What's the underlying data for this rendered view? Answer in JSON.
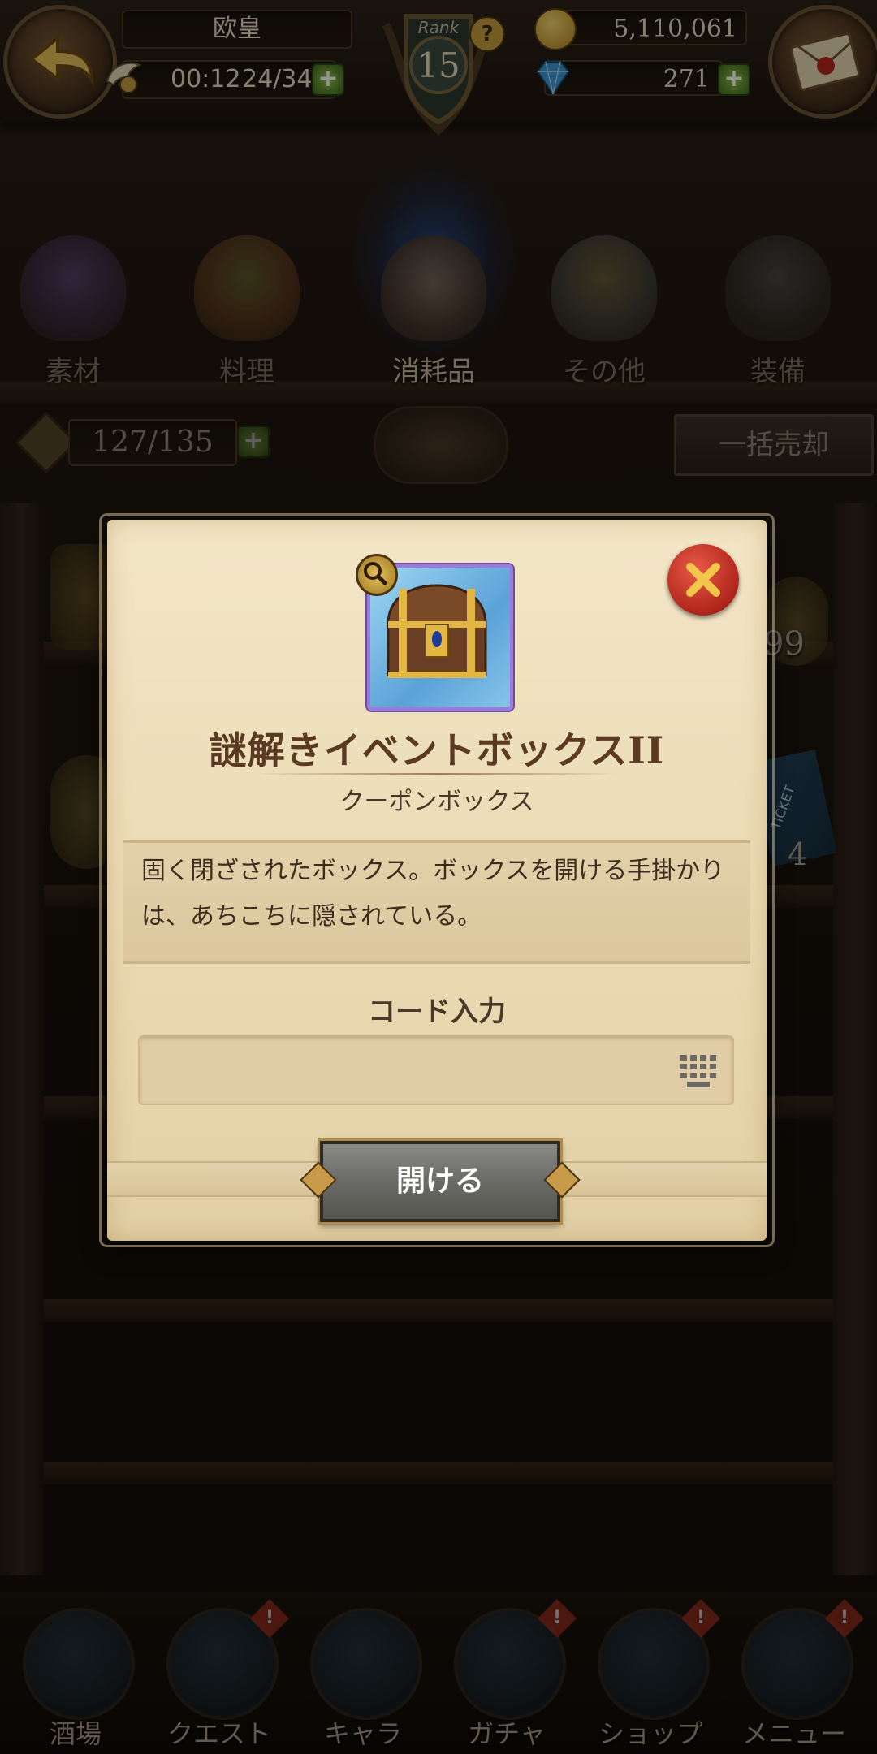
{
  "header": {
    "player_name": "欧皇",
    "stamina_timer": "00:12",
    "stamina": "24/34",
    "rank_label": "Rank",
    "rank_value": "15",
    "rank_help": "?",
    "gold": "5,110,061",
    "gems": "271",
    "plus": "+"
  },
  "categories": [
    {
      "label": "素材"
    },
    {
      "label": "料理"
    },
    {
      "label": "消耗品"
    },
    {
      "label": "その他"
    },
    {
      "label": "装備"
    }
  ],
  "inventory": {
    "count": "127/135",
    "bulk_sell_label": "一括売却"
  },
  "background_items": {
    "stack_99": "99",
    "ticket_text": "TICKET",
    "ticket_count": "4"
  },
  "dialog": {
    "title": "謎解きイベントボックスII",
    "subtitle": "クーポンボックス",
    "description": "固く閉ざされたボックス。ボックスを開ける手掛かりは、あちこちに隠されている。",
    "code_label": "コード入力",
    "code_value": "",
    "open_button": "開ける"
  },
  "bottom_nav": [
    {
      "label": "酒場",
      "alert": false
    },
    {
      "label": "クエスト",
      "alert": true
    },
    {
      "label": "キャラ",
      "alert": false
    },
    {
      "label": "ガチャ",
      "alert": true
    },
    {
      "label": "ショップ",
      "alert": true
    },
    {
      "label": "メニュー",
      "alert": true
    }
  ],
  "bottom_nav_alert": "!",
  "colors": {
    "parchment": "#ead9b2",
    "title_brown": "#5a3a22",
    "close_red": "#b0251b",
    "plus_green": "#6ea336",
    "gold": "#d9b24a"
  }
}
